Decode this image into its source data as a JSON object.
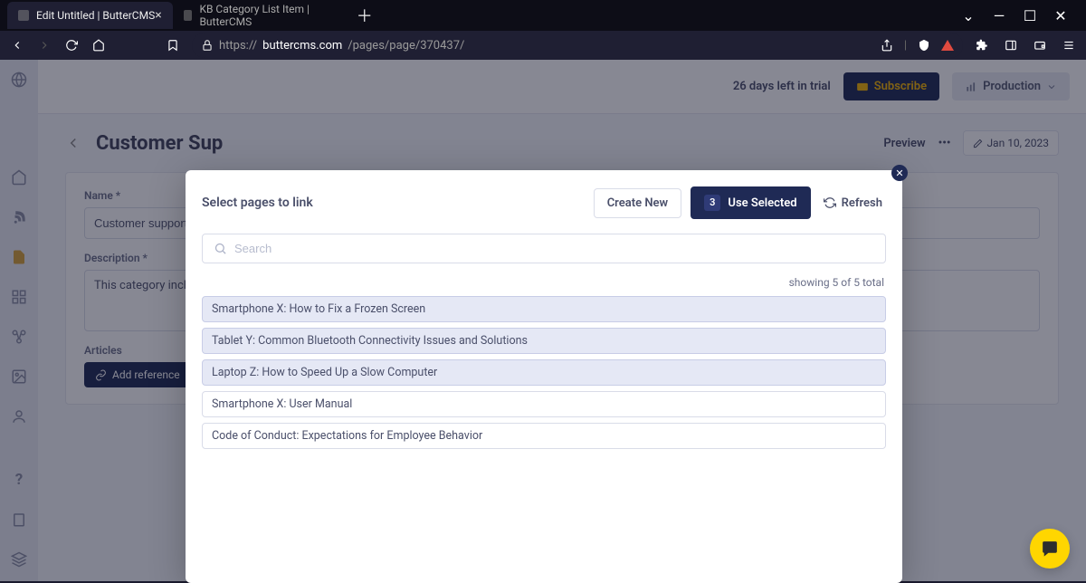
{
  "browser": {
    "tabs": [
      {
        "title": "Edit Untitled | ButterCMS",
        "active": true
      },
      {
        "title": "KB Category List Item | ButterCMS",
        "active": false
      }
    ],
    "url_prefix": "https://",
    "url_host": "buttercms.com",
    "url_path": "/pages/page/370437/"
  },
  "topbar": {
    "trial_text": "26 days left in trial",
    "subscribe_label": "Subscribe",
    "production_label": "Production"
  },
  "page": {
    "title_truncated": "Customer Sup",
    "preview_label": "Preview",
    "date": "Jan 10, 2023",
    "name_label": "Name *",
    "name_value": "Customer support",
    "desc_label": "Description *",
    "desc_value_truncated": "This category includes a",
    "articles_label": "Articles",
    "add_reference_label": "Add reference"
  },
  "modal": {
    "title": "Select pages to link",
    "create_new_label": "Create New",
    "use_selected_label": "Use Selected",
    "selected_count": "3",
    "refresh_label": "Refresh",
    "search_placeholder": "Search",
    "showing_text": "showing 5 of 5 total",
    "rows": [
      {
        "title": "Smartphone X: How to Fix a Frozen Screen",
        "selected": true
      },
      {
        "title": "Tablet Y: Common Bluetooth Connectivity Issues and Solutions",
        "selected": true
      },
      {
        "title": "Laptop Z: How to Speed Up a Slow Computer",
        "selected": true
      },
      {
        "title": "Smartphone X: User Manual",
        "selected": false
      },
      {
        "title": "Code of Conduct: Expectations for Employee Behavior",
        "selected": false
      }
    ]
  }
}
